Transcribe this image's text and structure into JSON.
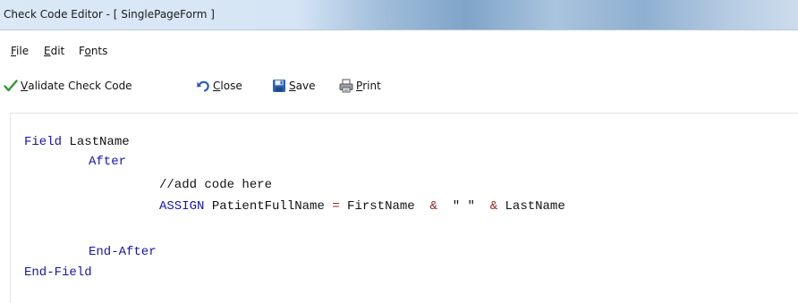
{
  "window": {
    "title": "Check Code Editor - [ SinglePageForm ]"
  },
  "menu": {
    "file": {
      "mnemonic": "F",
      "rest": "ile"
    },
    "edit": {
      "mnemonic": "E",
      "rest": "dit"
    },
    "fonts": {
      "pre": "F",
      "mnemonic": "o",
      "rest": "nts"
    }
  },
  "toolbar": {
    "validate": {
      "mnemonic": "V",
      "rest": "alidate Check Code",
      "icon": "checkmark-icon"
    },
    "close": {
      "mnemonic": "C",
      "rest": "lose",
      "icon": "undo-arrow-icon"
    },
    "save": {
      "mnemonic": "S",
      "rest": "ave",
      "icon": "floppy-disk-icon"
    },
    "print": {
      "mnemonic": "P",
      "rest": "rint",
      "icon": "printer-icon"
    }
  },
  "code": {
    "line1": {
      "kw": "Field",
      "rest": " LastName"
    },
    "line2": {
      "kw": "After"
    },
    "line3": {
      "comment": "//add code here"
    },
    "line4": {
      "kw": "ASSIGN",
      "target": " PatientFullName ",
      "eq": "=",
      "first": " FirstName  ",
      "amp1": "&",
      "str": "  \" \"  ",
      "amp2": "&",
      "last": " LastName"
    },
    "line5": {
      "kw": "End-After"
    },
    "line6": {
      "kw": "End-Field"
    }
  },
  "colors": {
    "keyword": "#1515b8",
    "operator": "#a02020",
    "validate_icon": "#2e9a2e"
  }
}
